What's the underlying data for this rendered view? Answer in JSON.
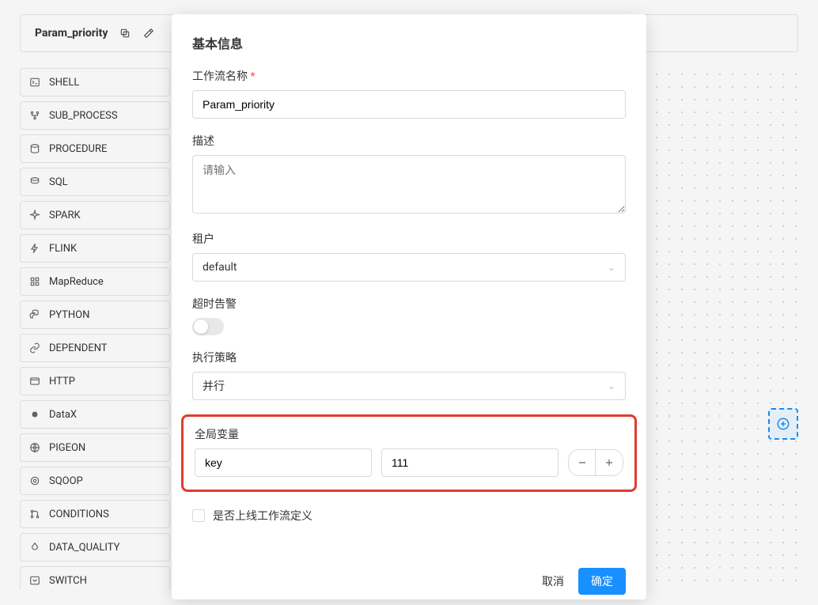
{
  "header": {
    "title": "Param_priority"
  },
  "sidebar": {
    "items": [
      {
        "label": "SHELL"
      },
      {
        "label": "SUB_PROCESS"
      },
      {
        "label": "PROCEDURE"
      },
      {
        "label": "SQL"
      },
      {
        "label": "SPARK"
      },
      {
        "label": "FLINK"
      },
      {
        "label": "MapReduce"
      },
      {
        "label": "PYTHON"
      },
      {
        "label": "DEPENDENT"
      },
      {
        "label": "HTTP"
      },
      {
        "label": "DataX"
      },
      {
        "label": "PIGEON"
      },
      {
        "label": "SQOOP"
      },
      {
        "label": "CONDITIONS"
      },
      {
        "label": "DATA_QUALITY"
      },
      {
        "label": "SWITCH"
      }
    ]
  },
  "modal": {
    "title": "基本信息",
    "workflow_name_label": "工作流名称",
    "workflow_name_value": "Param_priority",
    "description_label": "描述",
    "description_placeholder": "请输入",
    "tenant_label": "租户",
    "tenant_value": "default",
    "timeout_label": "超时告警",
    "policy_label": "执行策略",
    "policy_value": "并行",
    "globals_label": "全局变量",
    "globals_key": "key",
    "globals_value": "111",
    "online_label": "是否上线工作流定义",
    "cancel": "取消",
    "confirm": "确定"
  }
}
